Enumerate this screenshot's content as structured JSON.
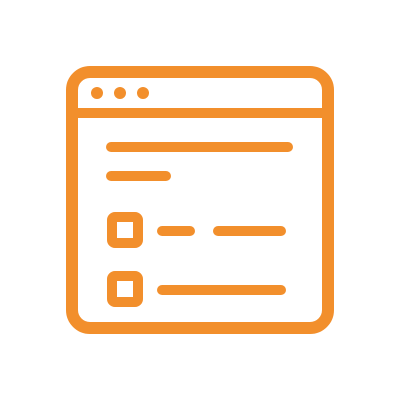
{
  "icon": {
    "name": "browser-window-checklist-icon",
    "stroke_color": "#F28F2C",
    "background": "#FFFFFF",
    "titlebar_dots": 3,
    "checklist": {
      "text_lines_above": 2,
      "items": [
        {
          "checked": false,
          "line_segments": 2
        },
        {
          "checked": false,
          "line_segments": 1
        }
      ]
    }
  }
}
